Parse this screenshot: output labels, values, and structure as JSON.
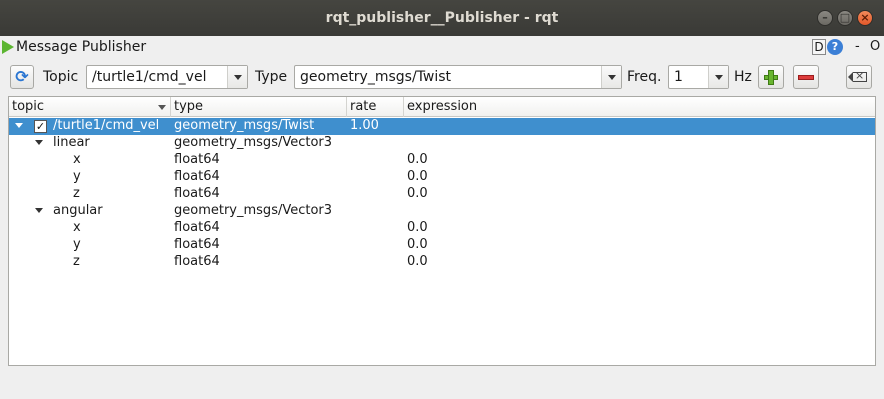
{
  "window": {
    "title": "rqt_publisher__Publisher - rqt"
  },
  "plugin": {
    "name": "Message Publisher",
    "d_label": "D",
    "help_label": "?",
    "minus_label": "-",
    "close_label": "O"
  },
  "toolbar": {
    "topic_label": "Topic",
    "topic_value": "/turtle1/cmd_vel",
    "type_label": "Type",
    "type_value": "geometry_msgs/Twist",
    "freq_label": "Freq.",
    "freq_value": "1",
    "hz_label": "Hz"
  },
  "tree": {
    "columns": [
      "topic",
      "type",
      "rate",
      "expression"
    ],
    "rows": [
      {
        "name": "/turtle1/cmd_vel",
        "type": "geometry_msgs/Twist",
        "rate": "1.00",
        "expression": "",
        "checked": true,
        "selected": true
      },
      {
        "name": "linear",
        "type": "geometry_msgs/Vector3",
        "rate": "",
        "expression": ""
      },
      {
        "name": "x",
        "type": "float64",
        "rate": "",
        "expression": "0.0"
      },
      {
        "name": "y",
        "type": "float64",
        "rate": "",
        "expression": "0.0"
      },
      {
        "name": "z",
        "type": "float64",
        "rate": "",
        "expression": "0.0"
      },
      {
        "name": "angular",
        "type": "geometry_msgs/Vector3",
        "rate": "",
        "expression": ""
      },
      {
        "name": "x",
        "type": "float64",
        "rate": "",
        "expression": "0.0"
      },
      {
        "name": "y",
        "type": "float64",
        "rate": "",
        "expression": "0.0"
      },
      {
        "name": "z",
        "type": "float64",
        "rate": "",
        "expression": "0.0"
      }
    ]
  },
  "colors": {
    "selection": "#3f8fce",
    "titlebar": "#3f3f3b",
    "add": "#68b52f",
    "remove": "#dd3b3b"
  }
}
